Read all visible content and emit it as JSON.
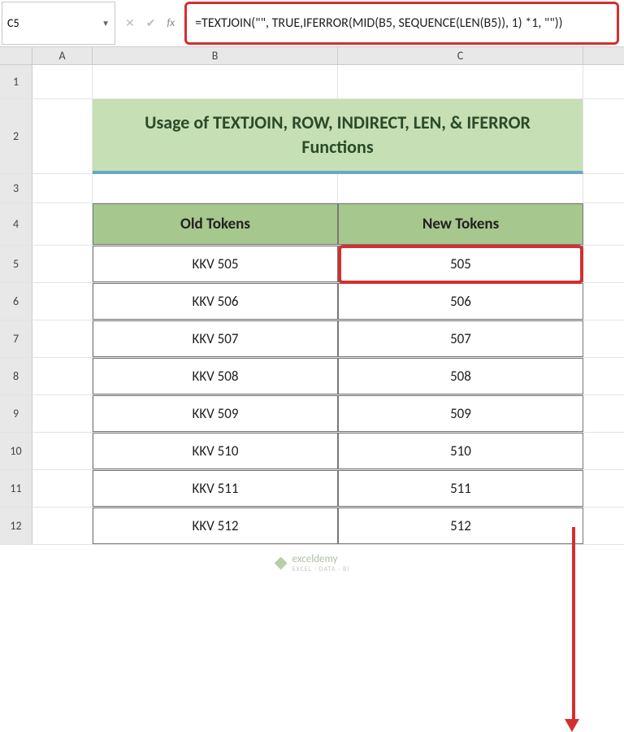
{
  "nameBox": {
    "value": "C5"
  },
  "formulaBar": {
    "value": "=TEXTJOIN(\"\", TRUE,IFERROR(MID(B5, SEQUENCE(LEN(B5)), 1) *1, \"\"))"
  },
  "columns": {
    "A": "A",
    "B": "B",
    "C": "C"
  },
  "rows": [
    "1",
    "2",
    "3",
    "4",
    "5",
    "6",
    "7",
    "8",
    "9",
    "10",
    "11",
    "12"
  ],
  "title": "Usage of  TEXTJOIN, ROW, INDIRECT, LEN, & IFERROR Functions",
  "headers": {
    "old": "Old Tokens",
    "new": "New Tokens"
  },
  "data": [
    {
      "old": "KKV 505",
      "new": "505"
    },
    {
      "old": "KKV 506",
      "new": "506"
    },
    {
      "old": "KKV 507",
      "new": "507"
    },
    {
      "old": "KKV 508",
      "new": "508"
    },
    {
      "old": "KKV 509",
      "new": "509"
    },
    {
      "old": "KKV 510",
      "new": "510"
    },
    {
      "old": "KKV 511",
      "new": "511"
    },
    {
      "old": "KKV 512",
      "new": "512"
    }
  ],
  "watermark": {
    "name": "exceldemy",
    "sub": "EXCEL · DATA · BI"
  },
  "chart_data": {
    "type": "table",
    "title": "Usage of TEXTJOIN, ROW, INDIRECT, LEN, & IFERROR Functions",
    "columns": [
      "Old Tokens",
      "New Tokens"
    ],
    "rows": [
      [
        "KKV 505",
        "505"
      ],
      [
        "KKV 506",
        "506"
      ],
      [
        "KKV 507",
        "507"
      ],
      [
        "KKV 508",
        "508"
      ],
      [
        "KKV 509",
        "509"
      ],
      [
        "KKV 510",
        "510"
      ],
      [
        "KKV 511",
        "511"
      ],
      [
        "KKV 512",
        "512"
      ]
    ]
  }
}
